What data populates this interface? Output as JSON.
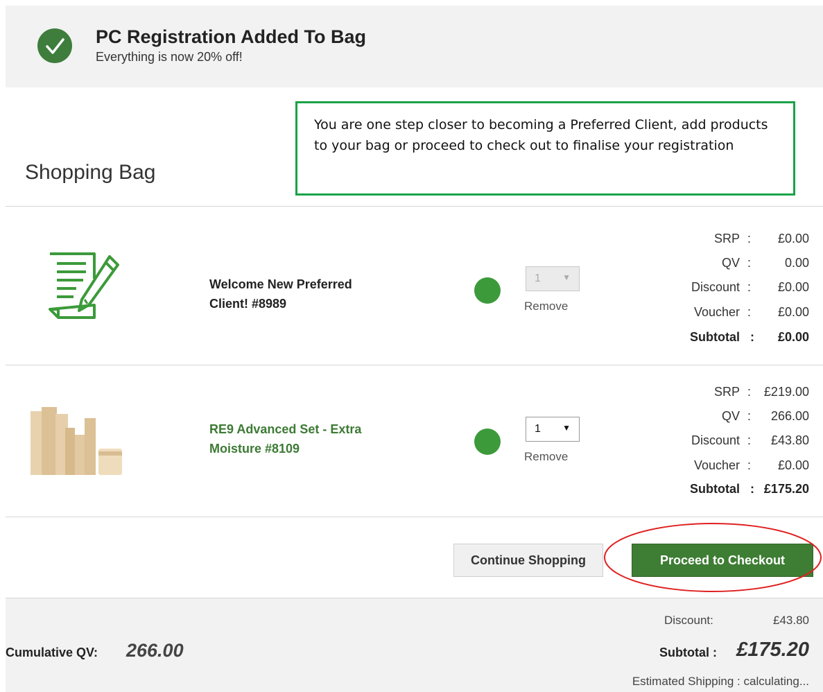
{
  "banner": {
    "title": "PC Registration Added To Bag",
    "subtitle": "Everything is now 20% off!",
    "icon": "check-circle-icon",
    "icon_color": "#3e7d3c"
  },
  "header": {
    "title": "Shopping Bag",
    "notice": "You are one step closer to becoming a Preferred Client, add products to your bag or proceed to check out to finalise your registration",
    "notice_border_color": "#19a347"
  },
  "items": [
    {
      "name_line1": "Welcome New Preferred",
      "name_line2": "Client! #8989",
      "image_icon": "registration-form-pencil-icon",
      "status_color": "#3c9a3a",
      "quantity": "1",
      "quantity_disabled": true,
      "remove_label": "Remove",
      "prices": {
        "srp_label": "SRP",
        "srp": "£0.00",
        "qv_label": "QV",
        "qv": "0.00",
        "discount_label": "Discount",
        "discount": "£0.00",
        "voucher_label": "Voucher",
        "voucher": "£0.00",
        "subtotal_label": "Subtotal",
        "subtotal": "£0.00"
      }
    },
    {
      "name_line1": "RE9 Advanced Set - Extra",
      "name_line2": "Moisture #8109",
      "image_icon": "product-bottles-image",
      "status_color": "#3c9a3a",
      "quantity": "1",
      "quantity_disabled": false,
      "remove_label": "Remove",
      "prices": {
        "srp_label": "SRP",
        "srp": "£219.00",
        "qv_label": "QV",
        "qv": "266.00",
        "discount_label": "Discount",
        "discount": "£43.80",
        "voucher_label": "Voucher",
        "voucher": "£0.00",
        "subtotal_label": "Subtotal",
        "subtotal": "£175.20"
      }
    }
  ],
  "actions": {
    "continue_label": "Continue Shopping",
    "checkout_label": "Proceed to Checkout",
    "checkout_color": "#3e7d34",
    "highlight_color": "#e02020"
  },
  "summary": {
    "cumulative_qv_label": "Cumulative QV:",
    "cumulative_qv": "266.00",
    "discount_label": "Discount:",
    "discount": "£43.80",
    "subtotal_label": "Subtotal :",
    "subtotal": "£175.20",
    "shipping_label": "Estimated Shipping :",
    "shipping": "calculating..."
  }
}
